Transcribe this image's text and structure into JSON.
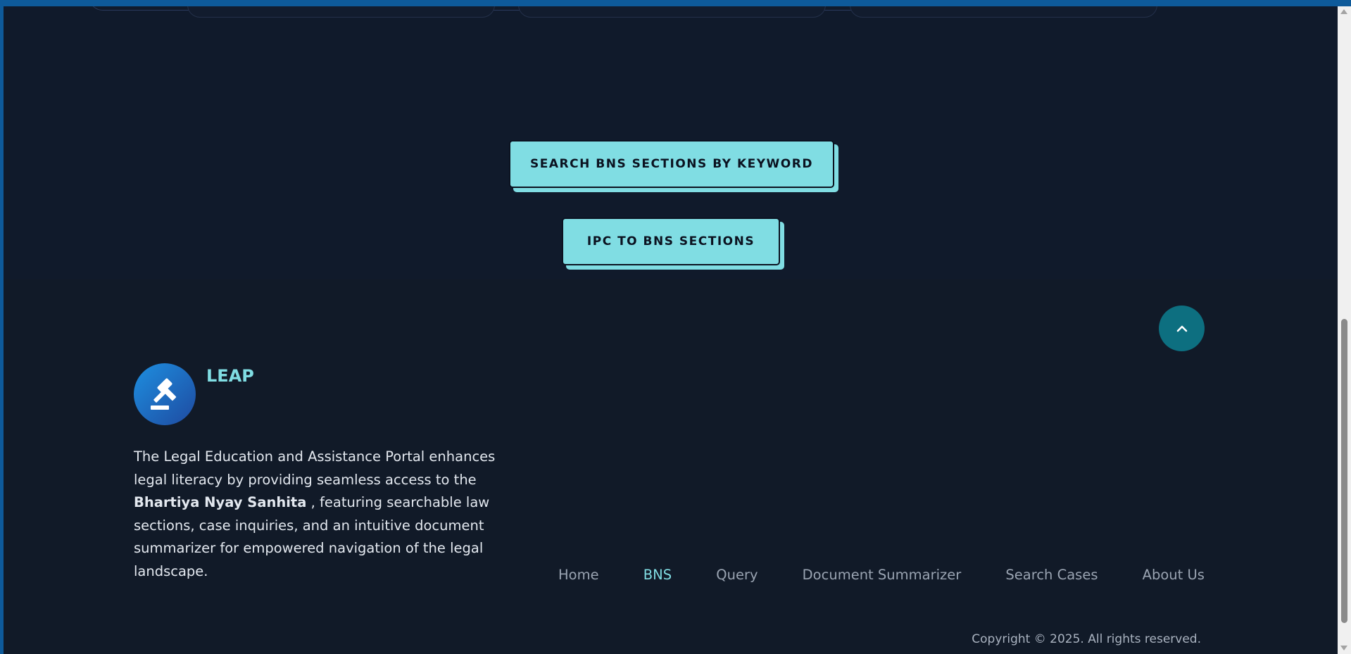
{
  "actions": {
    "keyword_search_label": "SEARCH BNS SECTIONS BY KEYWORD",
    "ipc_to_bns_label": "IPC TO BNS SECTIONS"
  },
  "footer": {
    "brand": "LEAP",
    "logo_icon": "gavel-icon",
    "about_intro": "The Legal Education and Assistance Portal enhances legal literacy by providing seamless access to the ",
    "about_bold": "Bhartiya Nyay Sanhita",
    "about_rest": " , featuring searchable law sections, case inquiries, and an intuitive document summarizer for empowered navigation of the legal landscape.",
    "nav": [
      {
        "label": "Home",
        "active": false
      },
      {
        "label": "BNS",
        "active": true
      },
      {
        "label": "Query",
        "active": false
      },
      {
        "label": "Document Summarizer",
        "active": false
      },
      {
        "label": "Search Cases",
        "active": false
      },
      {
        "label": "About Us",
        "active": false
      }
    ],
    "copyright": "Copyright © 2025. All rights reserved.",
    "back_to_top_icon": "chevron-up-icon"
  },
  "colors": {
    "accent": "#80dde3",
    "background": "#101828",
    "back_to_top": "#0d6f80",
    "logo_gradient_start": "#1d8fe0",
    "logo_gradient_end": "#1f4aa0"
  }
}
